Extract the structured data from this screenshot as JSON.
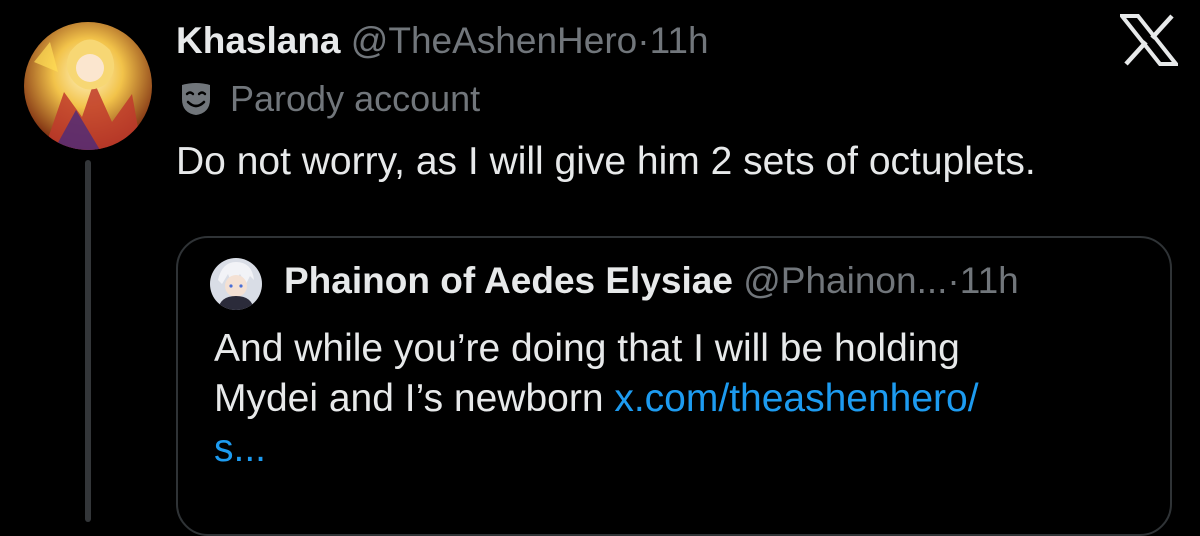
{
  "brand": {
    "logo": "x-logo-icon",
    "background": "#000000",
    "text_primary": "#e7e9ea",
    "text_secondary": "#71767b",
    "link": "#1d9bf0",
    "border": "#2f3336"
  },
  "tweet": {
    "display_name": "Khaslana",
    "handle": "@TheAshenHero",
    "separator": "·",
    "time": "11h",
    "label_icon": "parody-mask-icon",
    "label": "Parody account",
    "text": "Do not worry, as I will give him 2 sets of octuplets."
  },
  "quote": {
    "display_name": "Phainon of Aedes Elysiae",
    "handle": "@Phainon...",
    "separator": "·",
    "time": "11h",
    "text_line1": "And while you’re doing that I will be holding",
    "text_line2": "Mydei and I’s newborn ",
    "link_part1": "x.com/theashenhero/",
    "link_part2": "s..."
  }
}
